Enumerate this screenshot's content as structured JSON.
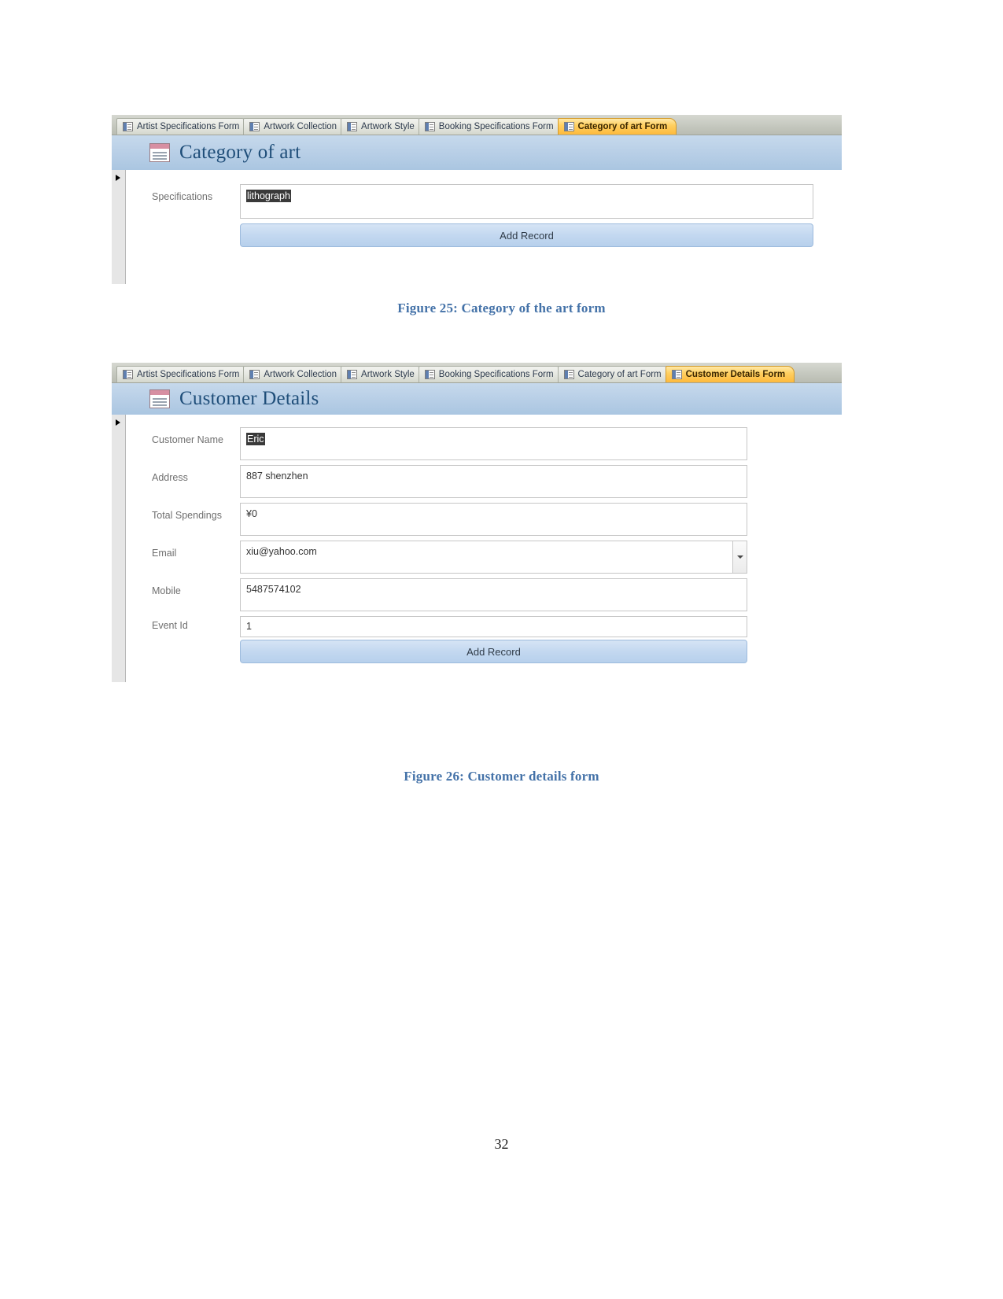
{
  "page": {
    "number": "32"
  },
  "figure25": {
    "caption": "Figure 25: Category of the art form",
    "window": {
      "tabs": [
        {
          "label": "Artist Specifications Form",
          "active": false
        },
        {
          "label": "Artwork Collection",
          "active": false
        },
        {
          "label": "Artwork Style",
          "active": false
        },
        {
          "label": "Booking Specifications Form",
          "active": false
        },
        {
          "label": "Category of art Form",
          "active": true
        }
      ],
      "header_title": "Category of art",
      "fields": [
        {
          "label": "Specifications",
          "value": "lithograph",
          "selected": true
        }
      ],
      "add_record_label": "Add Record"
    }
  },
  "figure26": {
    "caption": "Figure 26: Customer details form",
    "window": {
      "tabs": [
        {
          "label": "Artist Specifications Form",
          "active": false
        },
        {
          "label": "Artwork Collection",
          "active": false
        },
        {
          "label": "Artwork Style",
          "active": false
        },
        {
          "label": "Booking Specifications Form",
          "active": false
        },
        {
          "label": "Category of art Form",
          "active": false
        },
        {
          "label": "Customer Details Form",
          "active": true
        }
      ],
      "header_title": "Customer Details",
      "fields": [
        {
          "label": "Customer Name",
          "value": "Eric",
          "selected": true
        },
        {
          "label": "Address",
          "value": "887 shenzhen",
          "selected": false
        },
        {
          "label": "Total Spendings",
          "value": "¥0",
          "selected": false
        },
        {
          "label": "Email",
          "value": "xiu@yahoo.com",
          "selected": false,
          "combo": true
        },
        {
          "label": "Mobile",
          "value": "5487574102",
          "selected": false
        },
        {
          "label": "Event Id",
          "value": "1",
          "selected": false
        }
      ],
      "add_record_label": "Add Record"
    }
  },
  "colors": {
    "active_tab": "#fdb93c",
    "header_band": "#b7cee6",
    "title_text": "#1f4e79",
    "caption_text": "#4472a8",
    "button": "#c3d8f0"
  }
}
